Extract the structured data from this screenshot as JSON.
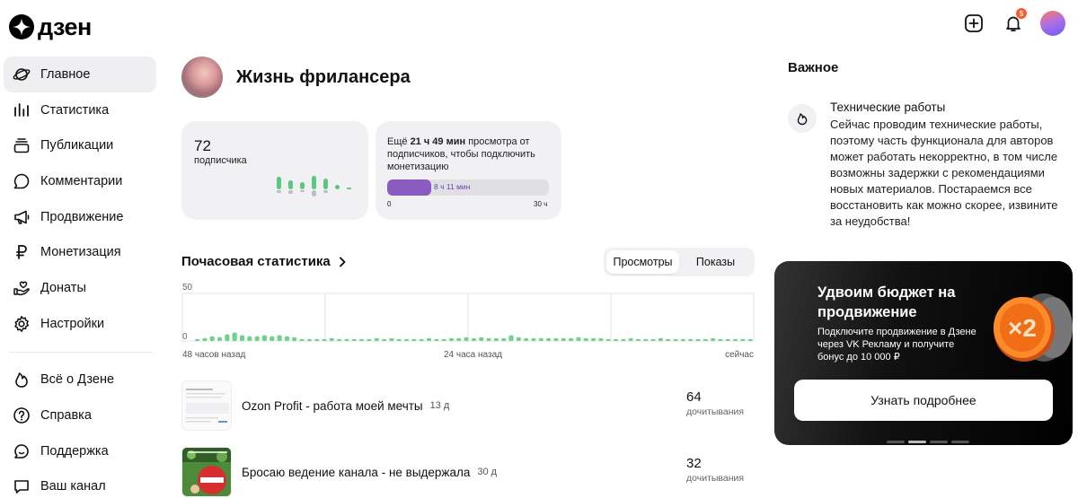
{
  "brand": {
    "name": "дзен"
  },
  "header": {
    "notifications_count": "5"
  },
  "sidebar": {
    "items": [
      {
        "label": "Главное",
        "icon": "planet-icon",
        "active": true
      },
      {
        "label": "Статистика",
        "icon": "stats-bars-icon"
      },
      {
        "label": "Публикации",
        "icon": "stack-icon"
      },
      {
        "label": "Комментарии",
        "icon": "comment-icon"
      },
      {
        "label": "Продвижение",
        "icon": "megaphone-icon"
      },
      {
        "label": "Монетизация",
        "icon": "ruble-icon"
      },
      {
        "label": "Донаты",
        "icon": "hand-heart-icon"
      },
      {
        "label": "Настройки",
        "icon": "gear-icon"
      }
    ],
    "secondary": [
      {
        "label": "Всё о Дзене",
        "icon": "flame-icon"
      },
      {
        "label": "Справка",
        "icon": "help-icon"
      },
      {
        "label": "Поддержка",
        "icon": "support-chat-icon"
      },
      {
        "label": "Ваш канал",
        "icon": "channel-icon"
      }
    ]
  },
  "channel": {
    "name": "Жизнь фрилансера"
  },
  "subscribers": {
    "count": "72",
    "label": "подписчика"
  },
  "monetization": {
    "text_prefix": "Ещё ",
    "hours": "21 ч 49 мин",
    "text_suffix": " просмотра от подписчиков, чтобы подключить монетизацию",
    "progress_label": "8 ч 11 мин",
    "progress_fraction": 0.273,
    "min_label": "0",
    "max_label": "30 ч"
  },
  "hourly": {
    "title": "Почасовая статистика",
    "tabs": [
      {
        "label": "Просмотры",
        "active": true
      },
      {
        "label": "Показы"
      }
    ],
    "axis": {
      "ymax": "50",
      "ymin": "0",
      "x_left": "48 часов назад",
      "x_mid": "24 часа назад",
      "x_right": "сейчас"
    }
  },
  "chart_data": {
    "type": "bar",
    "ylim": [
      0,
      50
    ],
    "values": [
      2,
      3,
      5,
      4,
      7,
      9,
      6,
      5,
      5,
      6,
      5,
      6,
      5,
      4,
      2,
      2,
      2,
      2,
      3,
      2,
      2,
      2,
      2,
      2,
      3,
      2,
      3,
      2,
      2,
      2,
      2,
      3,
      2,
      2,
      3,
      3,
      4,
      3,
      4,
      3,
      3,
      3,
      6,
      4,
      3,
      3,
      3,
      3,
      3,
      3,
      3,
      4,
      3,
      3,
      3,
      2,
      2,
      2,
      3,
      2,
      2,
      2,
      3,
      2,
      2,
      2,
      2,
      2,
      2,
      3,
      2,
      2,
      2,
      2,
      2
    ],
    "color": "#6fd18b"
  },
  "publications": [
    {
      "title": "Ozon Profit - работа моей мечты",
      "age": "13 д",
      "reads": "64",
      "reads_label": "дочитывания"
    },
    {
      "title": "Бросаю ведение канала - не выдержала",
      "age": "30 д",
      "reads": "32",
      "reads_label": "дочитывания"
    }
  ],
  "important": {
    "title": "Важное",
    "notice_title": "Технические работы",
    "notice_body": "Сейчас проводим технические работы, поэтому часть функционала для авторов может работать некорректно, в том числе возможны задержки с рекомендациями новых материалов. Постараемся все восстановить как можно скорее, извините за неудобства!"
  },
  "promo": {
    "title": "Удвоим бюджет на продвижение",
    "text": "Подключите продвижение в Дзене через VK Рекламу и получите бонус до 10 000 ₽",
    "coin_label": "×2",
    "button": "Узнать подробнее"
  },
  "colors": {
    "accent_green": "#6fd18b",
    "accent_purple": "#8a5cc0",
    "badge": "#ff5a2c"
  }
}
